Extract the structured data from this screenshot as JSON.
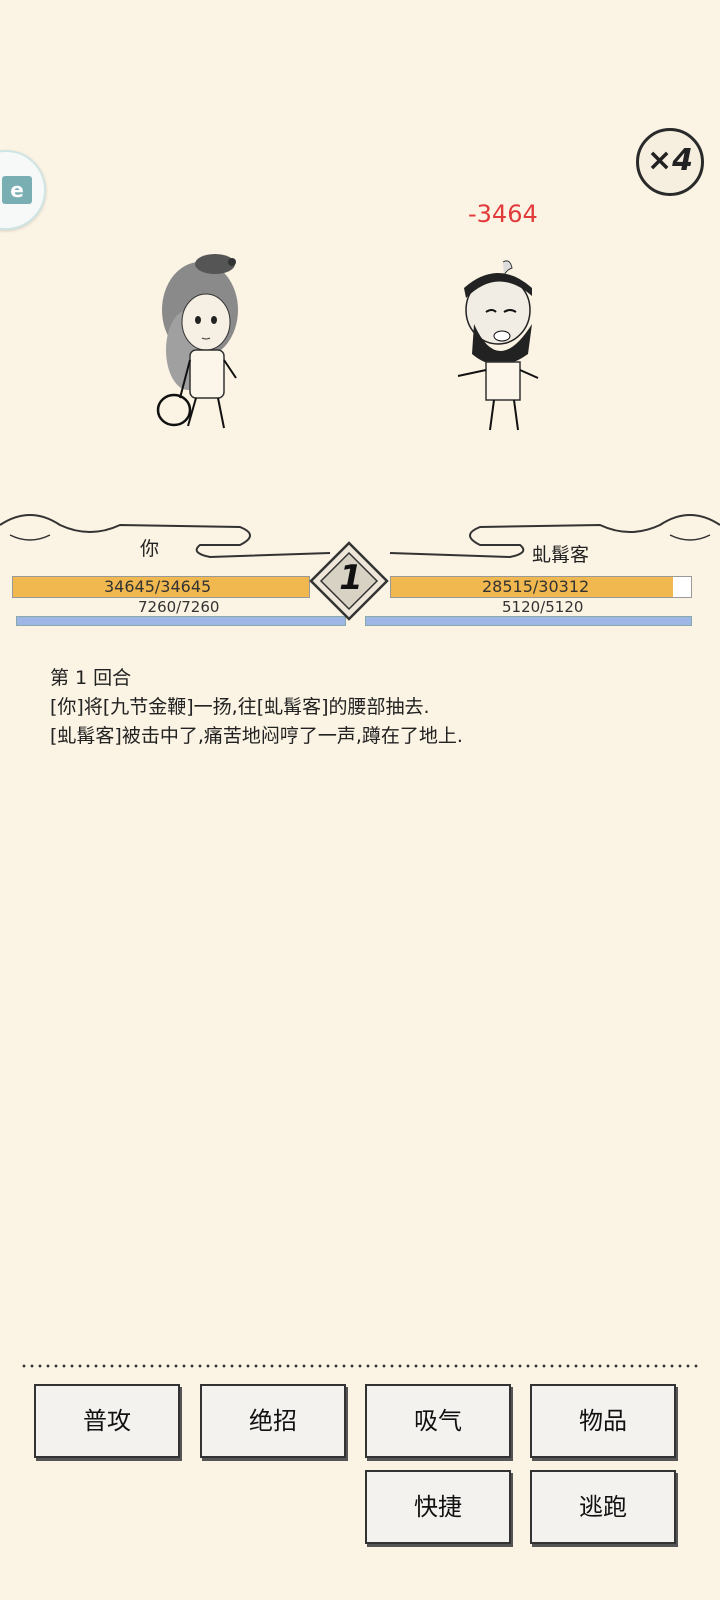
{
  "side_badge": {
    "icon": "app-badge-icon",
    "text": "e"
  },
  "speed": {
    "label": "×4"
  },
  "damage": {
    "text": "-3464",
    "color": "#e23a3a"
  },
  "hero": {
    "name": "你",
    "hp_text": "34645/34645",
    "mp_text": "7260/7260",
    "hp_ratio": 1.0,
    "mp_ratio": 1.0
  },
  "enemy": {
    "name": "虬髯客",
    "hp_text": "28515/30312",
    "mp_text": "5120/5120",
    "hp_ratio": 0.9407,
    "mp_ratio": 1.0
  },
  "round": {
    "number": "1"
  },
  "log": {
    "lines": [
      "第 1 回合",
      "[你]将[九节金鞭]一扬,往[虬髯客]的腰部抽去.",
      "[虬髯客]被击中了,痛苦地闷哼了一声,蹲在了地上."
    ]
  },
  "actions": {
    "attack": "普攻",
    "ultimate": "绝招",
    "breathe": "吸气",
    "items": "物品",
    "quick": "快捷",
    "flee": "逃跑"
  },
  "colors": {
    "bg": "#fbf3e3",
    "hp": "#f0b84f",
    "mp": "#9eb6e5"
  }
}
